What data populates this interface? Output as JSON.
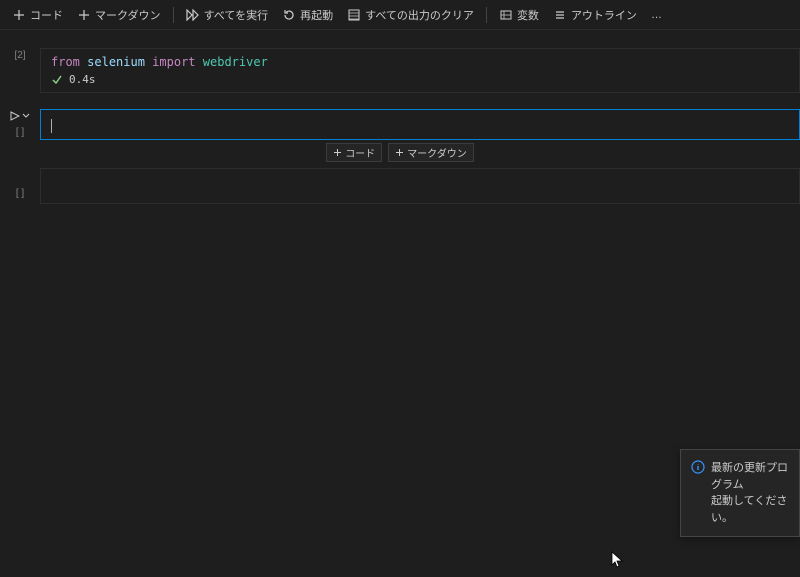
{
  "toolbar": {
    "code": "コード",
    "markdown": "マークダウン",
    "runAll": "すべてを実行",
    "restart": "再起動",
    "clearAll": "すべての出力のクリア",
    "variables": "変数",
    "outline": "アウトライン",
    "more": "…"
  },
  "cells": [
    {
      "execCount": "[2]",
      "code": {
        "from": "from",
        "mod1": "selenium",
        "import": "import",
        "mod2": "webdriver"
      },
      "statusTime": "0.4s"
    }
  ],
  "insertBar": {
    "code": "コード",
    "markdown": "マークダウン"
  },
  "toast": {
    "line1": "最新の更新プログラム",
    "line2": "起動してください。"
  }
}
